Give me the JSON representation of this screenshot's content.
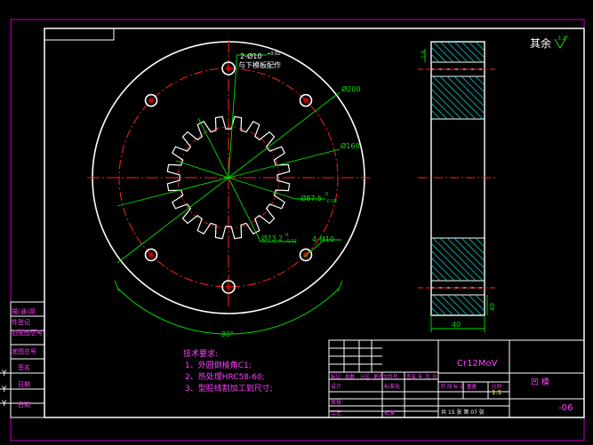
{
  "colors": {
    "background": "#000000",
    "outline": "#ffffff",
    "frame": "#c000c0",
    "centerline": "#ff2020",
    "dimension": "#00e000",
    "hatch": "#00e0e0",
    "notes": "#ff40ff",
    "title_block": "#ff40ff",
    "yellow_text": "#ffff00"
  },
  "front_view": {
    "label_hole_top": "2-Ø10",
    "label_hole_top_sup": "+0.02",
    "label_hole_note": "与下模板配作",
    "label_d200": "Ø200",
    "label_d160": "Ø160",
    "label_d875": "Ø87.5",
    "label_d875_sup": "0",
    "label_d875_sub": "-0.08",
    "label_d732": "Ø73.2",
    "label_d732_sup": "0",
    "label_d732_sub": "-0.02",
    "label_thread": "4-M10",
    "label_angle": "90°"
  },
  "side_view": {
    "roughness_top": "1.6",
    "width_label": "40",
    "height_label": "40"
  },
  "roughness": {
    "prefix": "其余",
    "value": "3.2"
  },
  "tech_notes": {
    "title": "技术要求:",
    "items": [
      "1、外圆倒棱角C1;",
      "2、热处理HRC58-60;",
      "3、型腔线割加工到尺寸;"
    ]
  },
  "left_strip": {
    "labels": [
      "描(通)用",
      "件登记",
      "旧底图总号",
      "底图总号",
      "签名",
      "日期",
      "日期"
    ]
  },
  "title_block": {
    "material": "Cr12MoV",
    "part_name": "凹  模",
    "drawing_no": "-06",
    "header_row": [
      "标记",
      "处数",
      "分区",
      "更改文件号",
      "签名",
      "年",
      "月",
      "日"
    ],
    "row_labels": [
      "设计",
      "标准化",
      "审核",
      "工艺",
      "批准"
    ],
    "stage_labels": [
      "阶",
      "段",
      "标",
      "记",
      "重量",
      "比例"
    ],
    "scale": "1:1",
    "sheets": "共 1S 张  第 07 张"
  }
}
